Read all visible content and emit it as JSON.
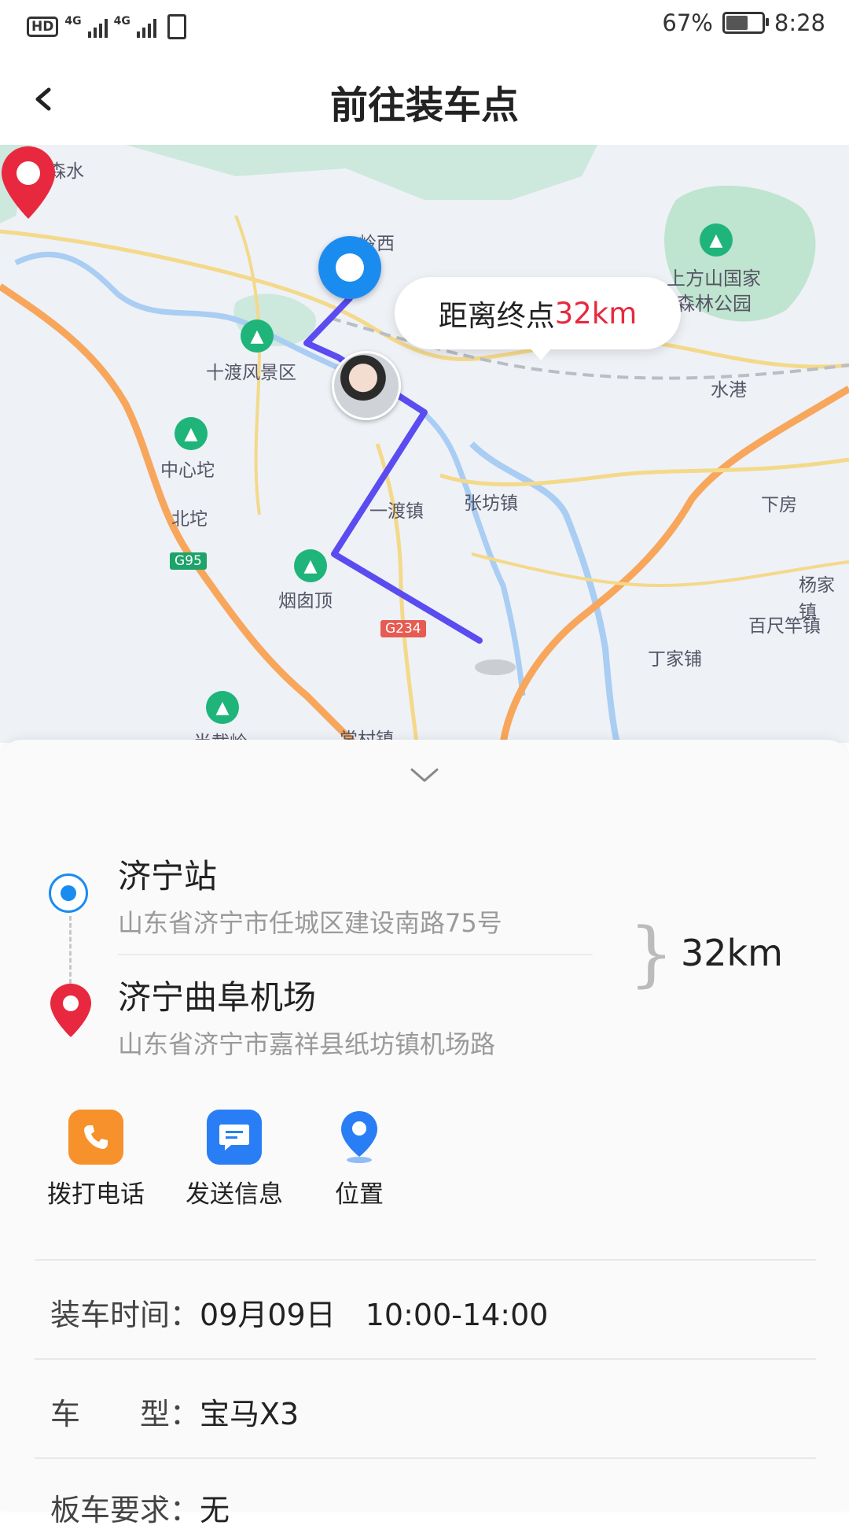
{
  "status_bar": {
    "left_badge": "HD",
    "network_1": "4G",
    "network_2": "4G",
    "battery_percent": "67%",
    "battery_level": 0.67,
    "time": "8:28"
  },
  "header": {
    "title": "前往装车点",
    "back_icon": "chevron-left-icon"
  },
  "map": {
    "bubble_prefix": "距离终点",
    "bubble_distance": "32km",
    "labels": {
      "xisenshui": "西森水",
      "lingxi": "岭西",
      "shangfangshan": "上方山国家",
      "senlingongyuan": "森林公园",
      "shidu": "十渡风景区",
      "shuigang": "水港",
      "zhongxintuo": "中心坨",
      "beituo": "北坨",
      "yidu": "一渡镇",
      "zhangfang": "张坊镇",
      "xiafang": "下房",
      "yangjiayi": "杨家镇",
      "baichigan": "百尺竿镇",
      "dingjiapu": "丁家铺",
      "yancongding": "烟囱顶",
      "banjieling": "半截岭",
      "kuancun": "常村镇"
    },
    "shields": {
      "g95": "G95",
      "g234": "G234"
    },
    "colors": {
      "route": "#5a4cf0",
      "start": "#1a8cf0",
      "end": "#e8283f"
    }
  },
  "sheet": {
    "collapse_icon": "chevron-down-icon",
    "start_name": "济宁站",
    "start_addr": "山东省济宁市任城区建设南路75号",
    "end_name": "济宁曲阜机场",
    "end_addr": "山东省济宁市嘉祥县纸坊镇机场路",
    "distance": "32km",
    "actions": [
      {
        "label": "拨打电话",
        "icon": "phone-icon",
        "color": "#f7912c"
      },
      {
        "label": "发送信息",
        "icon": "message-icon",
        "color": "#2a7ef5"
      },
      {
        "label": "位置",
        "icon": "location-pin-icon",
        "color": "#2a7ef5"
      }
    ],
    "info": {
      "load_time_label": "装车时间：",
      "load_time_date": "09月09日",
      "load_time_range": "10:00-14:00",
      "car_type_label": "车　　型：",
      "car_type_value": "宝马X3",
      "truck_req_label": "板车要求：",
      "truck_req_value": "无"
    }
  }
}
